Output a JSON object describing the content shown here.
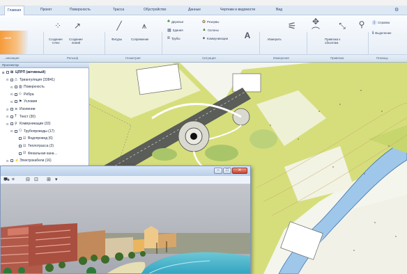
{
  "tabs": [
    {
      "label": "Главная",
      "active": true
    },
    {
      "label": "Проект"
    },
    {
      "label": "Поверхность"
    },
    {
      "label": "Трасса"
    },
    {
      "label": "Обустройство"
    },
    {
      "label": "Данные"
    },
    {
      "label": "Чертежи и ведомости"
    },
    {
      "label": "Вид"
    }
  ],
  "ribbon": {
    "first_group_label_top": "…ание",
    "first_group_label_bottom": "…анизация",
    "create_point": "Создание\nточек",
    "create_line": "Создание\nлиний",
    "figures": "Фигуры",
    "features": "Сопряжение",
    "trees": "Деревья",
    "buildings": "Здания",
    "pipes": "Трубы",
    "grounds": "Резервы",
    "slopes": "Склоны",
    "communications": "Коммуникации",
    "measure": "Измерить",
    "assign_objects": "Привязка к\nобъектам",
    "help": "Справка",
    "selection": "Выделение"
  },
  "groups": [
    "Подготовка",
    "Рельеф",
    "Геометрия",
    "Ситуация",
    "Измерения",
    "Привязка",
    "Помощь"
  ],
  "prospector": {
    "header": "Проспектор",
    "items": [
      {
        "label": "ЦПРП (активный)",
        "bold": true,
        "level": 0
      },
      {
        "label": "Триангуляция (33841)",
        "level": 1
      },
      {
        "label": "Поверхность",
        "level": 2
      },
      {
        "label": "Рёбра",
        "level": 2
      },
      {
        "label": "Условия",
        "level": 2
      },
      {
        "label": "Изолинии",
        "level": 1
      },
      {
        "label": "Текст (30)",
        "level": 1
      },
      {
        "label": "Коммуникации (33)",
        "level": 1
      },
      {
        "label": "Трубопроводы (17)",
        "level": 2
      },
      {
        "label": "Водопровод (6)",
        "level": 3
      },
      {
        "label": "Теплотрасса (2)",
        "level": 3
      },
      {
        "label": "Фекальная кана…",
        "level": 3
      },
      {
        "label": "Электрокабели (16)",
        "level": 1
      }
    ]
  },
  "viewer": {
    "toolbar_icons": [
      "camera-icon",
      "grid-icon",
      "view-front-icon",
      "view-side-icon",
      "render-icon"
    ]
  },
  "colors": {
    "ribbon_accent": "#f59b3b",
    "land": "#d3dc70",
    "road": "#5b5d58",
    "water": "#9fc7ea",
    "sky": "#b9bcc4"
  }
}
